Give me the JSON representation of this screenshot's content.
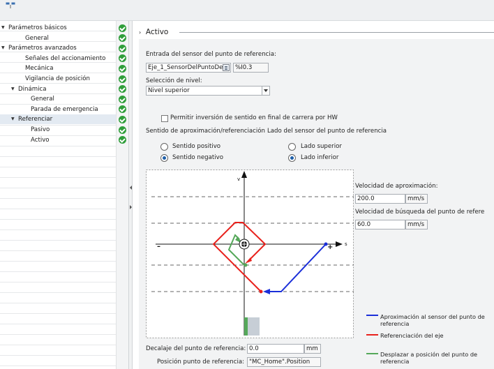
{
  "colors": {
    "check_green": "#2f9e3a",
    "approach": "#1b2fd9",
    "referencing": "#e8211c",
    "shift": "#55a85a",
    "accent_blue": "#1f5fa8"
  },
  "tree": {
    "items": [
      {
        "label": "Parámetros básicos",
        "indent": 0,
        "expander": "expanded",
        "selected": false
      },
      {
        "label": "General",
        "indent": 1,
        "expander": "",
        "selected": false
      },
      {
        "label": "Parámetros avanzados",
        "indent": 0,
        "expander": "expanded",
        "selected": false
      },
      {
        "label": "Señales del accionamiento",
        "indent": 1,
        "expander": "",
        "selected": false
      },
      {
        "label": "Mecánica",
        "indent": 1,
        "expander": "",
        "selected": false
      },
      {
        "label": "Vigilancia de posición",
        "indent": 1,
        "expander": "",
        "selected": false
      },
      {
        "label": "Dinámica",
        "indent": 1,
        "expander": "expanded",
        "selected": false
      },
      {
        "label": "General",
        "indent": 2,
        "expander": "",
        "selected": false
      },
      {
        "label": "Parada de emergencia",
        "indent": 2,
        "expander": "",
        "selected": false
      },
      {
        "label": "Referenciar",
        "indent": 1,
        "expander": "expanded",
        "selected": true
      },
      {
        "label": "Pasivo",
        "indent": 2,
        "expander": "",
        "selected": false
      },
      {
        "label": "Activo",
        "indent": 2,
        "expander": "",
        "selected": false
      }
    ]
  },
  "section": {
    "title": "Activo"
  },
  "sensor": {
    "label": "Entrada del sensor del punto de referencia:",
    "tag_value": "Eje_1_SensorDelPuntoDeR",
    "address_value": "%I0.3"
  },
  "level": {
    "label": "Selección de nivel:",
    "value": "Nivel superior"
  },
  "permit_reversal": {
    "label": "Permitir inversión de sentido en final de carrera por HW",
    "checked": false
  },
  "direction": {
    "label": "Sentido de aproximación/referenciación",
    "options": [
      "Sentido positivo",
      "Sentido negativo"
    ],
    "selected": "Sentido negativo"
  },
  "sensor_side": {
    "label": "Lado del sensor del punto de referencia",
    "options": [
      "Lado superior",
      "Lado inferior"
    ],
    "selected": "Lado inferior"
  },
  "diagram": {
    "axis_v": "v",
    "axis_s": "s",
    "minus": "–",
    "plus": "+"
  },
  "approach_velocity": {
    "label": "Velocidad de aproximación:",
    "value": "200.0",
    "unit": "mm/s"
  },
  "search_velocity": {
    "label": "Velocidad de búsqueda del punto de refere",
    "value": "60.0",
    "unit": "mm/s"
  },
  "offset": {
    "label": "Decalaje del punto de referencia:",
    "value": "0.0",
    "unit": "mm"
  },
  "ref_position": {
    "label": "Posición punto de referencia:",
    "value": "\"MC_Home\".Position"
  },
  "legend": [
    {
      "text": "Aproximación al sensor del punto de referencia",
      "color": "#1b2fd9"
    },
    {
      "text": "Referenciación del eje",
      "color": "#e8211c"
    },
    {
      "text": "Desplazar a posición del punto de referencia",
      "color": "#55a85a"
    }
  ]
}
